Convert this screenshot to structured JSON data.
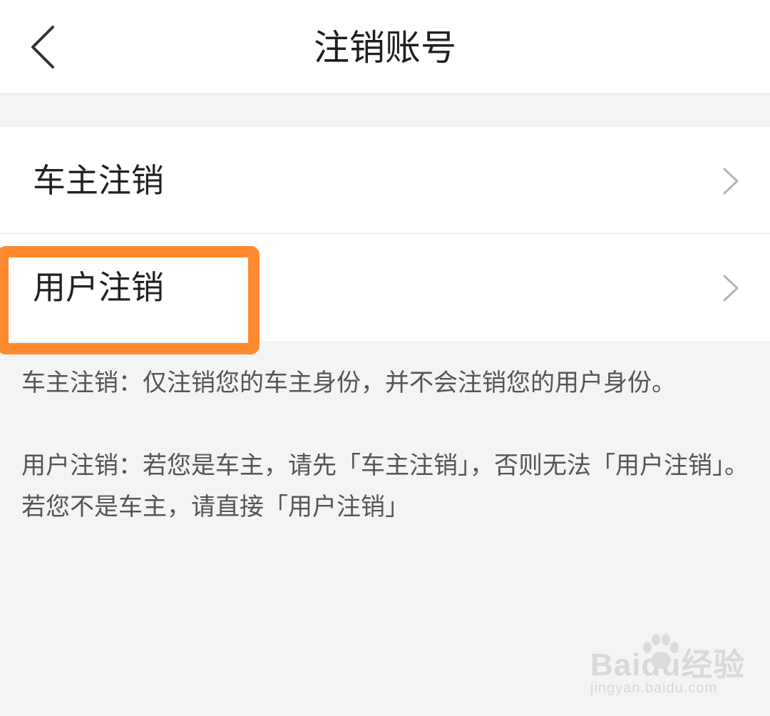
{
  "header": {
    "title": "注销账号",
    "back_icon": "back-arrow-icon"
  },
  "menu": {
    "items": [
      {
        "label": "车主注销",
        "icon": "chevron-right-icon"
      },
      {
        "label": "用户注销",
        "icon": "chevron-right-icon"
      }
    ]
  },
  "notes": [
    "车主注销：仅注销您的车主身份，并不会注销您的用户身份。",
    "用户注销：若您是车主，请先「车主注销」，否则无法「用户注销」。若您不是车主，请直接「用户注销」"
  ],
  "watermark": {
    "brand": "Baidu经验",
    "url": "jingyan.baidu.com"
  },
  "colors": {
    "highlight": "#ff8a30",
    "background": "#f4f4f4",
    "text": "#222222",
    "note_text": "#555555"
  }
}
